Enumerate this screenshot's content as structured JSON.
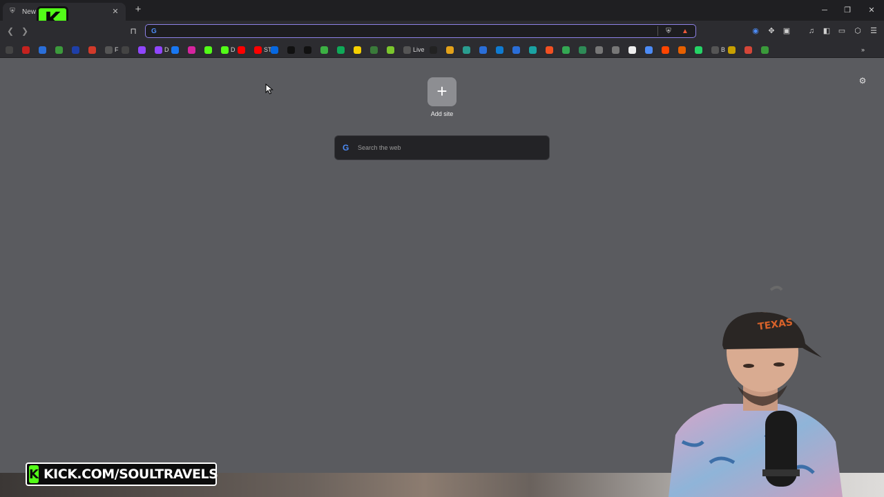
{
  "window": {
    "tab_title": "New T",
    "tab_close": "✕",
    "new_tab": "+",
    "controls": [
      "─",
      "❐",
      "✕"
    ]
  },
  "overlay": {
    "kick_logo_letter": "K",
    "banner_text": "KICK.COM/SOULTRAVELS",
    "brand_color": "#53fc18"
  },
  "toolbar": {
    "omnibox_value": "",
    "omnibox_engine_icon": "G",
    "accent_color": "#8e82e8"
  },
  "bookmarks": [
    {
      "icon": "apps-grid-icon",
      "label": "",
      "color": "#444"
    },
    {
      "icon": "gmail-icon",
      "label": "",
      "color": "#c5221f"
    },
    {
      "icon": "shield-icon",
      "label": "",
      "color": "#2a6ed8"
    },
    {
      "icon": "download-icon",
      "label": "",
      "color": "#3c9a3c"
    },
    {
      "icon": "a-icon",
      "label": "",
      "color": "#1e3fa8"
    },
    {
      "icon": "g-icon",
      "label": "",
      "color": "#d23a2a"
    },
    {
      "icon": "folder-icon",
      "label": "F",
      "color": "#555"
    },
    {
      "icon": "s-icon",
      "label": "",
      "color": "#444"
    },
    {
      "icon": "twitch-icon",
      "label": "",
      "color": "#9146ff"
    },
    {
      "icon": "twitch-icon",
      "label": "D",
      "color": "#9146ff"
    },
    {
      "icon": "facebook-icon",
      "label": "",
      "color": "#1877f2"
    },
    {
      "icon": "instagram-icon",
      "label": "",
      "color": "#d6249f"
    },
    {
      "icon": "kick-icon",
      "label": "",
      "color": "#53fc18"
    },
    {
      "icon": "kick-icon",
      "label": "D",
      "color": "#53fc18"
    },
    {
      "icon": "youtube-icon",
      "label": "",
      "color": "#ff0000"
    },
    {
      "icon": "youtube-icon",
      "label": "ST",
      "color": "#ff0000"
    },
    {
      "icon": "meta-icon",
      "label": "",
      "color": "#0668e1"
    },
    {
      "icon": "tiktok-icon",
      "label": "",
      "color": "#111"
    },
    {
      "icon": "x-icon",
      "label": "",
      "color": "#111"
    },
    {
      "icon": "chart-icon",
      "label": "",
      "color": "#3cb043"
    },
    {
      "icon": "green-icon",
      "label": "",
      "color": "#0fa958"
    },
    {
      "icon": "note-icon",
      "label": "",
      "color": "#f5d000"
    },
    {
      "icon": "circle-icon",
      "label": "",
      "color": "#3a7a3a"
    },
    {
      "icon": "puzzle-icon",
      "label": "",
      "color": "#7bc62d"
    },
    {
      "icon": "folder-icon",
      "label": "Live",
      "color": "#555"
    },
    {
      "icon": "amazon-icon",
      "label": "",
      "color": "#222"
    },
    {
      "icon": "bars-icon",
      "label": "",
      "color": "#e3a21a"
    },
    {
      "icon": "arrow-icon",
      "label": "",
      "color": "#2a9d8f"
    },
    {
      "icon": "circle-icon",
      "label": "",
      "color": "#2a6ed8"
    },
    {
      "icon": "edge-icon",
      "label": "",
      "color": "#0f7bd1"
    },
    {
      "icon": "circle-icon",
      "label": "",
      "color": "#2a6ed8"
    },
    {
      "icon": "square-icon",
      "label": "",
      "color": "#1aa3a3"
    },
    {
      "icon": "microsoft-icon",
      "label": "",
      "color": "#f25022"
    },
    {
      "icon": "drive-icon",
      "label": "",
      "color": "#34a853"
    },
    {
      "icon": "leaf-icon",
      "label": "",
      "color": "#2e8b57"
    },
    {
      "icon": "globe-icon",
      "label": "",
      "color": "#777"
    },
    {
      "icon": "globe-icon",
      "label": "",
      "color": "#777"
    },
    {
      "icon": "diamond-icon",
      "label": "",
      "color": "#eee"
    },
    {
      "icon": "search-icon",
      "label": "",
      "color": "#4c8bf5"
    },
    {
      "icon": "reddit-icon",
      "label": "",
      "color": "#ff4500"
    },
    {
      "icon": "fox-icon",
      "label": "",
      "color": "#e66000"
    },
    {
      "icon": "phone-icon",
      "label": "",
      "color": "#25d366"
    },
    {
      "icon": "folder-icon",
      "label": "B",
      "color": "#555"
    },
    {
      "icon": "coin-icon",
      "label": "",
      "color": "#c8a000"
    },
    {
      "icon": "mail-icon",
      "label": "",
      "color": "#d44638"
    },
    {
      "icon": "plant-icon",
      "label": "",
      "color": "#3a9a3a"
    }
  ],
  "newtab": {
    "add_site_symbol": "+",
    "add_site_label": "Add site",
    "search_placeholder": "Search the web",
    "search_engine_icon": "G",
    "settings_icon": "⚙"
  }
}
